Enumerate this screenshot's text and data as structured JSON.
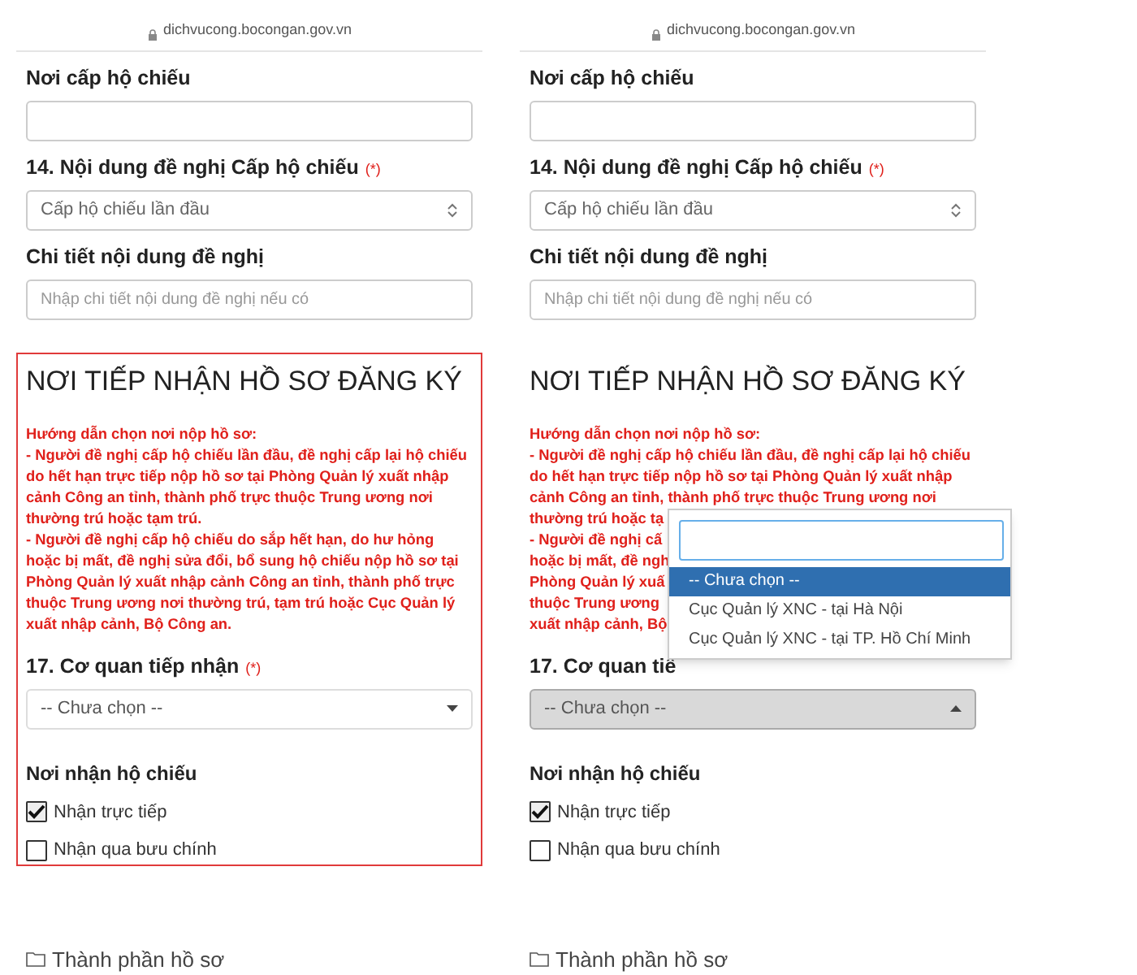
{
  "panels": [
    {
      "url": "dichvucong.bocongan.gov.vn",
      "highlighted": true,
      "fields": [
        {
          "kind": "input",
          "label": "Nơi cấp hộ chiếu"
        },
        {
          "kind": "select",
          "label": "14. Nội dung đề nghị Cấp hộ chiếu",
          "required_mark": "(*)",
          "value": "Cấp hộ chiếu lần đầu"
        },
        {
          "kind": "input",
          "label": "Chi tiết nội dung đề nghị",
          "placeholder": "Nhập chi tiết nội dung đề nghị nếu có"
        }
      ],
      "section": {
        "title": "NƠI TIẾP NHẬN HỒ SƠ ĐĂNG KÝ",
        "guide_lines": [
          "Hướng dẫn chọn nơi nộp hồ sơ:",
          "- Người đề nghị cấp hộ chiếu lần đầu, đề nghị cấp lại hộ chiếu",
          "do hết hạn trực tiếp nộp hồ sơ tại Phòng Quản lý xuất nhập",
          "cảnh Công an tỉnh, thành phố trực thuộc Trung ương nơi",
          "thường trú hoặc tạm trú.",
          "- Người đề nghị cấp hộ chiếu do sắp hết hạn, do hư hỏng",
          "hoặc bị mất, đề nghị sửa đổi, bổ sung hộ chiếu nộp hồ sơ tại",
          "Phòng Quản lý xuất nhập cảnh Công an tỉnh, thành phố trực",
          "thuộc Trung ương nơi thường trú, tạm trú hoặc Cục Quản lý",
          "xuất nhập cảnh, Bộ Công an."
        ],
        "agency_label": "17. Cơ quan tiếp nhận",
        "agency_required_mark": "(*)",
        "agency_select": {
          "value": "-- Chưa chọn --",
          "open": false
        },
        "delivery_label": "Nơi nhận hộ chiếu",
        "delivery_options": [
          {
            "label": "Nhận trực tiếp",
            "checked": true
          },
          {
            "label": "Nhận qua bưu chính",
            "checked": false
          }
        ]
      },
      "footer": "Thành phần hồ sơ"
    },
    {
      "url": "dichvucong.bocongan.gov.vn",
      "highlighted": false,
      "fields": [
        {
          "kind": "input",
          "label": "Nơi cấp hộ chiếu"
        },
        {
          "kind": "select",
          "label": "14. Nội dung đề nghị Cấp hộ chiếu",
          "required_mark": "(*)",
          "value": "Cấp hộ chiếu lần đầu"
        },
        {
          "kind": "input",
          "label": "Chi tiết nội dung đề nghị",
          "placeholder": "Nhập chi tiết nội dung đề nghị nếu có"
        }
      ],
      "section": {
        "title": "NƠI TIẾP NHẬN HỒ SƠ ĐĂNG KÝ",
        "guide_lines": [
          "Hướng dẫn chọn nơi nộp hồ sơ:",
          "- Người đề nghị cấp hộ chiếu lần đầu, đề nghị cấp lại hộ chiếu",
          "do hết hạn trực tiếp nộp hồ sơ tại Phòng Quản lý xuất nhập",
          "cảnh Công an tỉnh, thành phố trực thuộc Trung ương nơi",
          "thường trú hoặc tạ",
          "- Người đề nghị cấ",
          "hoặc bị mất, đề ngh",
          "Phòng Quản lý xuấ",
          "thuộc Trung ương",
          "xuất nhập cảnh, Bộ"
        ],
        "agency_label": "17. Cơ quan tiế",
        "agency_select": {
          "value": "-- Chưa chọn --",
          "open": true
        },
        "dropdown": {
          "options": [
            {
              "label": "-- Chưa chọn --",
              "selected": true
            },
            {
              "label": "Cục Quản lý XNC - tại Hà Nội",
              "selected": false
            },
            {
              "label": "Cục Quản lý XNC - tại TP. Hồ Chí Minh",
              "selected": false
            }
          ]
        },
        "delivery_label": "Nơi nhận hộ chiếu",
        "delivery_options": [
          {
            "label": "Nhận trực tiếp",
            "checked": true
          },
          {
            "label": "Nhận qua bưu chính",
            "checked": false
          }
        ]
      },
      "footer": "Thành phần hồ sơ"
    }
  ]
}
